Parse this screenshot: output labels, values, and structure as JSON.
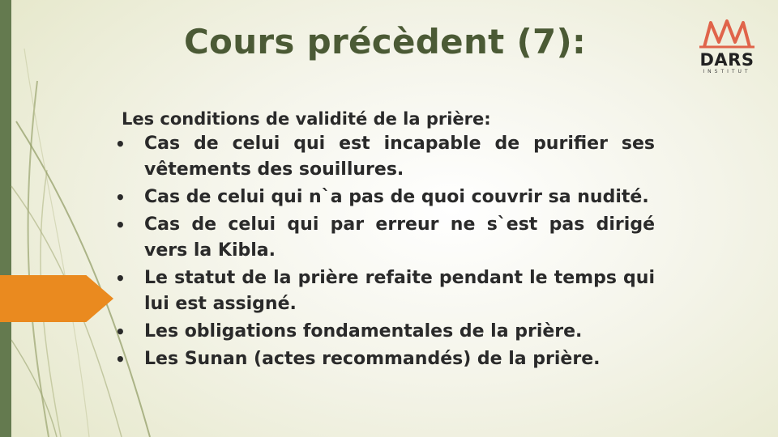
{
  "slide": {
    "title": "Cours précèdent (7):",
    "intro": "Les conditions de validité de la prière:",
    "bullets": [
      "Cas de celui qui est incapable de purifier ses vêtements des souillures.",
      "Cas de celui qui n`a pas de quoi couvrir sa nudité.",
      "Cas de celui qui par erreur ne s`est pas dirigé vers la Kibla.",
      "Le statut de la prière refaite pendant le temps qui lui est assigné.",
      "Les obligations fondamentales de la prière.",
      "Les Sunan (actes recommandés) de la prière."
    ],
    "bullet_symbol": "•"
  },
  "logo": {
    "word": "DARS",
    "sub": "INSTITUT"
  },
  "colors": {
    "title": "#4b5a35",
    "accent_bar": "#647a4f",
    "arrow": "#ea8a1f",
    "logo_mark": "#e0644a"
  }
}
